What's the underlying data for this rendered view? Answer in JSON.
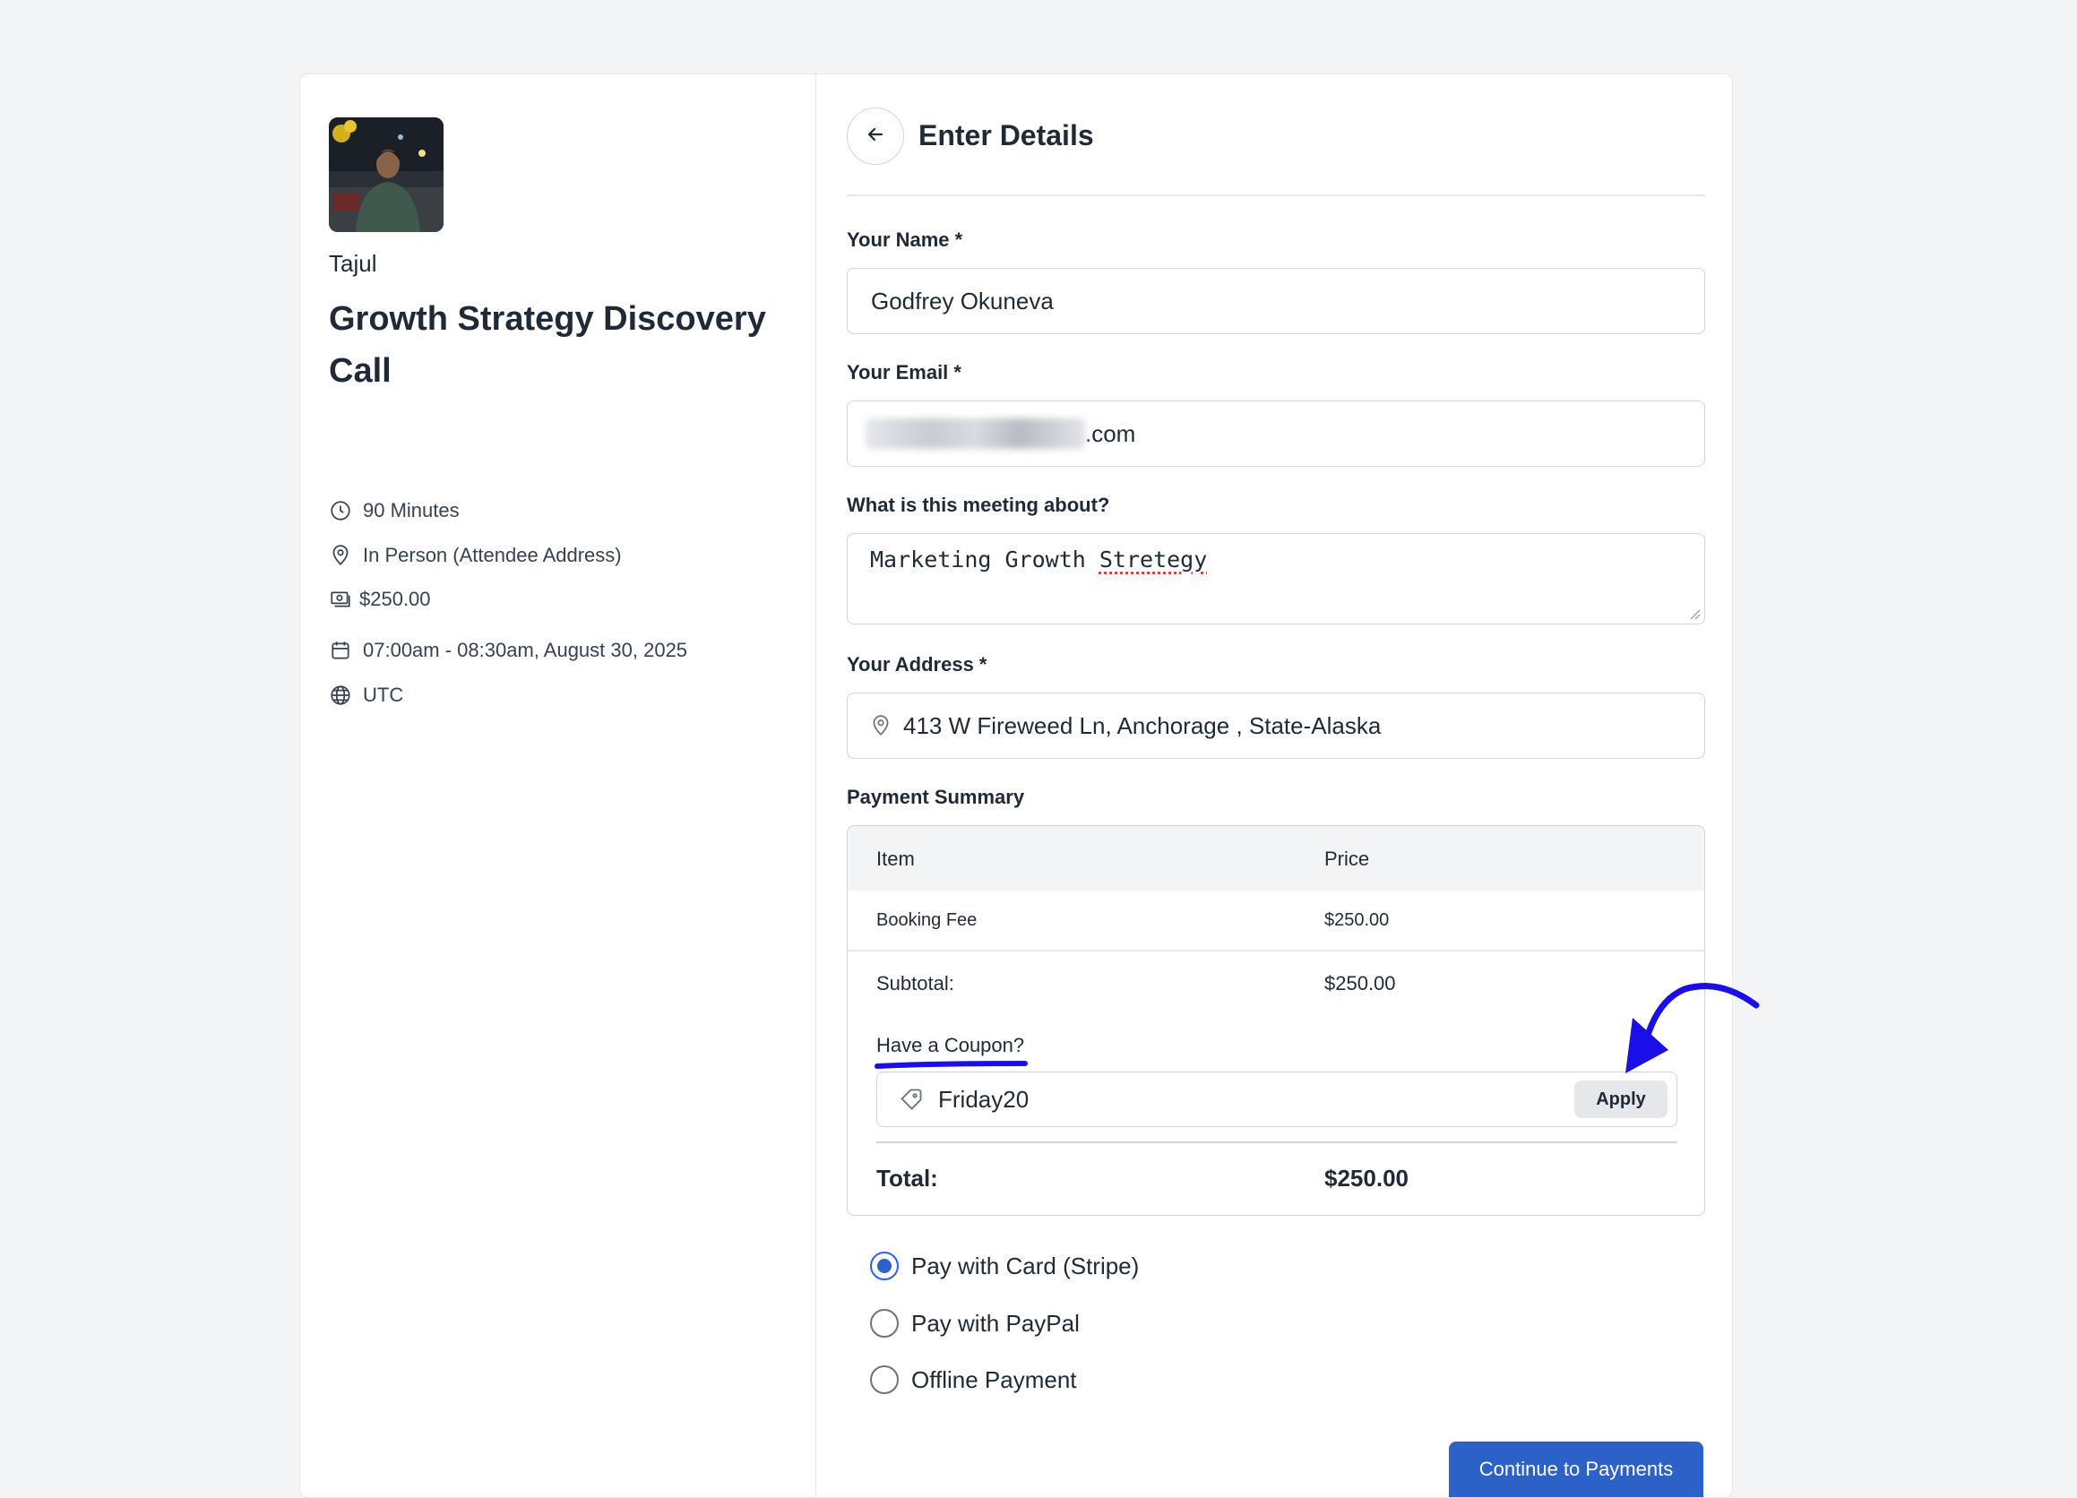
{
  "host": {
    "name": "Tajul"
  },
  "event": {
    "title": "Growth Strategy Discovery Call",
    "duration": "90 Minutes",
    "location": "In Person (Attendee Address)",
    "price": "$250.00",
    "datetime": "07:00am - 08:30am, August 30, 2025",
    "timezone": "UTC"
  },
  "form": {
    "header": "Enter Details",
    "name_label": "Your Name *",
    "name_value": "Godfrey Okuneva",
    "email_label": "Your Email *",
    "email_suffix": ".com",
    "about_label": "What is this meeting about?",
    "about_value_a": "Marketing Growth ",
    "about_value_b": "Stretegy",
    "address_label": "Your Address *",
    "address_value": "413 W Fireweed Ln, Anchorage , State-Alaska"
  },
  "payment": {
    "title": "Payment Summary",
    "col_item": "Item",
    "col_price": "Price",
    "rows": [
      {
        "item": "Booking Fee",
        "price": "$250.00"
      }
    ],
    "subtotal_label": "Subtotal:",
    "subtotal_value": "$250.00",
    "coupon_link": "Have a Coupon?",
    "coupon_value": "Friday20",
    "apply_label": "Apply",
    "total_label": "Total:",
    "total_value": "$250.00"
  },
  "methods": [
    {
      "label": "Pay with Card (Stripe)",
      "selected": true
    },
    {
      "label": "Pay with PayPal",
      "selected": false
    },
    {
      "label": "Offline Payment",
      "selected": false
    }
  ],
  "continue_label": "Continue to Payments",
  "colors": {
    "primary": "#2c62c7",
    "annotation": "#1a0fe8",
    "border": "#d1d5db"
  },
  "icons": [
    "clock-icon",
    "map-pin-icon",
    "money-icon",
    "calendar-icon",
    "globe-icon",
    "arrow-left-icon",
    "tag-icon"
  ]
}
